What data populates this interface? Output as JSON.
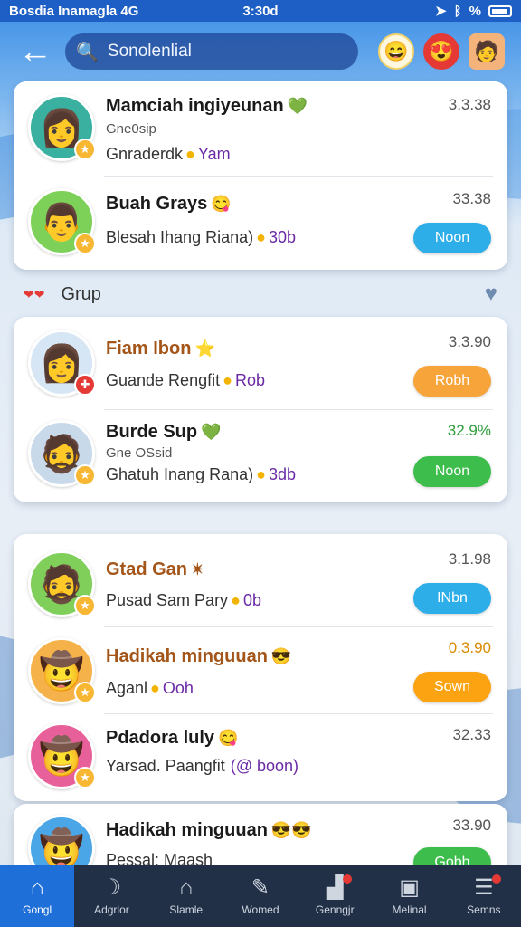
{
  "status_bar": {
    "carrier": "Bosdia Inamagla 4G",
    "time": "3:30d",
    "icons": [
      "location-icon",
      "bluetooth-icon",
      "percent-icon",
      "battery-icon"
    ],
    "percent": "%"
  },
  "header": {
    "search_text": "Sonolenlial"
  },
  "section": {
    "title": "Grup"
  },
  "card1": [
    {
      "name": "Mamciah ingiyeunan",
      "emo": "💚",
      "sub": "Gne0sip",
      "detail": "Gnraderdk",
      "detail_hl": "Yam",
      "time": "3.3.38"
    },
    {
      "name": "Buah Grays",
      "emo": "😋",
      "detail": "Blesah Ihang Riana)",
      "detail_hl": "30b",
      "time": "33.38",
      "button": "Noon"
    }
  ],
  "card2": [
    {
      "name": "Fiam Ibon",
      "emo": "⭐",
      "detail": "Guande Rengfit",
      "detail_hl": "Rob",
      "time": "3.3.90",
      "button": "Robh"
    },
    {
      "name": "Burde Sup",
      "emo": "💚",
      "sub": "Gne OSsid",
      "detail": "Ghatuh Inang Rana)",
      "detail_hl": "3db",
      "time": "32.9%",
      "button": "Noon"
    }
  ],
  "card3": [
    {
      "name": "Gtad Gan",
      "emo": "✴",
      "detail": "Pusad Sam Pary",
      "detail_hl": "0b",
      "time": "3.1.98",
      "button": "INbn"
    },
    {
      "name": "Hadikah minguuan",
      "emo": "😎",
      "detail": "Aganl",
      "detail_hl": "Ooh",
      "time": "0.3.90",
      "button": "Sown"
    },
    {
      "name": "Pdadora luly",
      "emo": "😋",
      "detail": "Yarsad. Paangfit",
      "detail_hl": "(@ boon)",
      "time": "32.33"
    }
  ],
  "card4": [
    {
      "name": "Hadikah minguuan",
      "emo": "😎😎",
      "detail": "Pessal: Maash",
      "time": "33.90",
      "button": "Gobh"
    }
  ],
  "nav": [
    {
      "label": "Gongl",
      "icon": "home-icon"
    },
    {
      "label": "Adgrlor",
      "icon": "moon-icon"
    },
    {
      "label": "Slamle",
      "icon": "house-icon"
    },
    {
      "label": "Womed",
      "icon": "edit-icon"
    },
    {
      "label": "Genngjr",
      "icon": "chart-icon"
    },
    {
      "label": "Melinal",
      "icon": "message-icon"
    },
    {
      "label": "Semns",
      "icon": "menu-icon"
    }
  ]
}
